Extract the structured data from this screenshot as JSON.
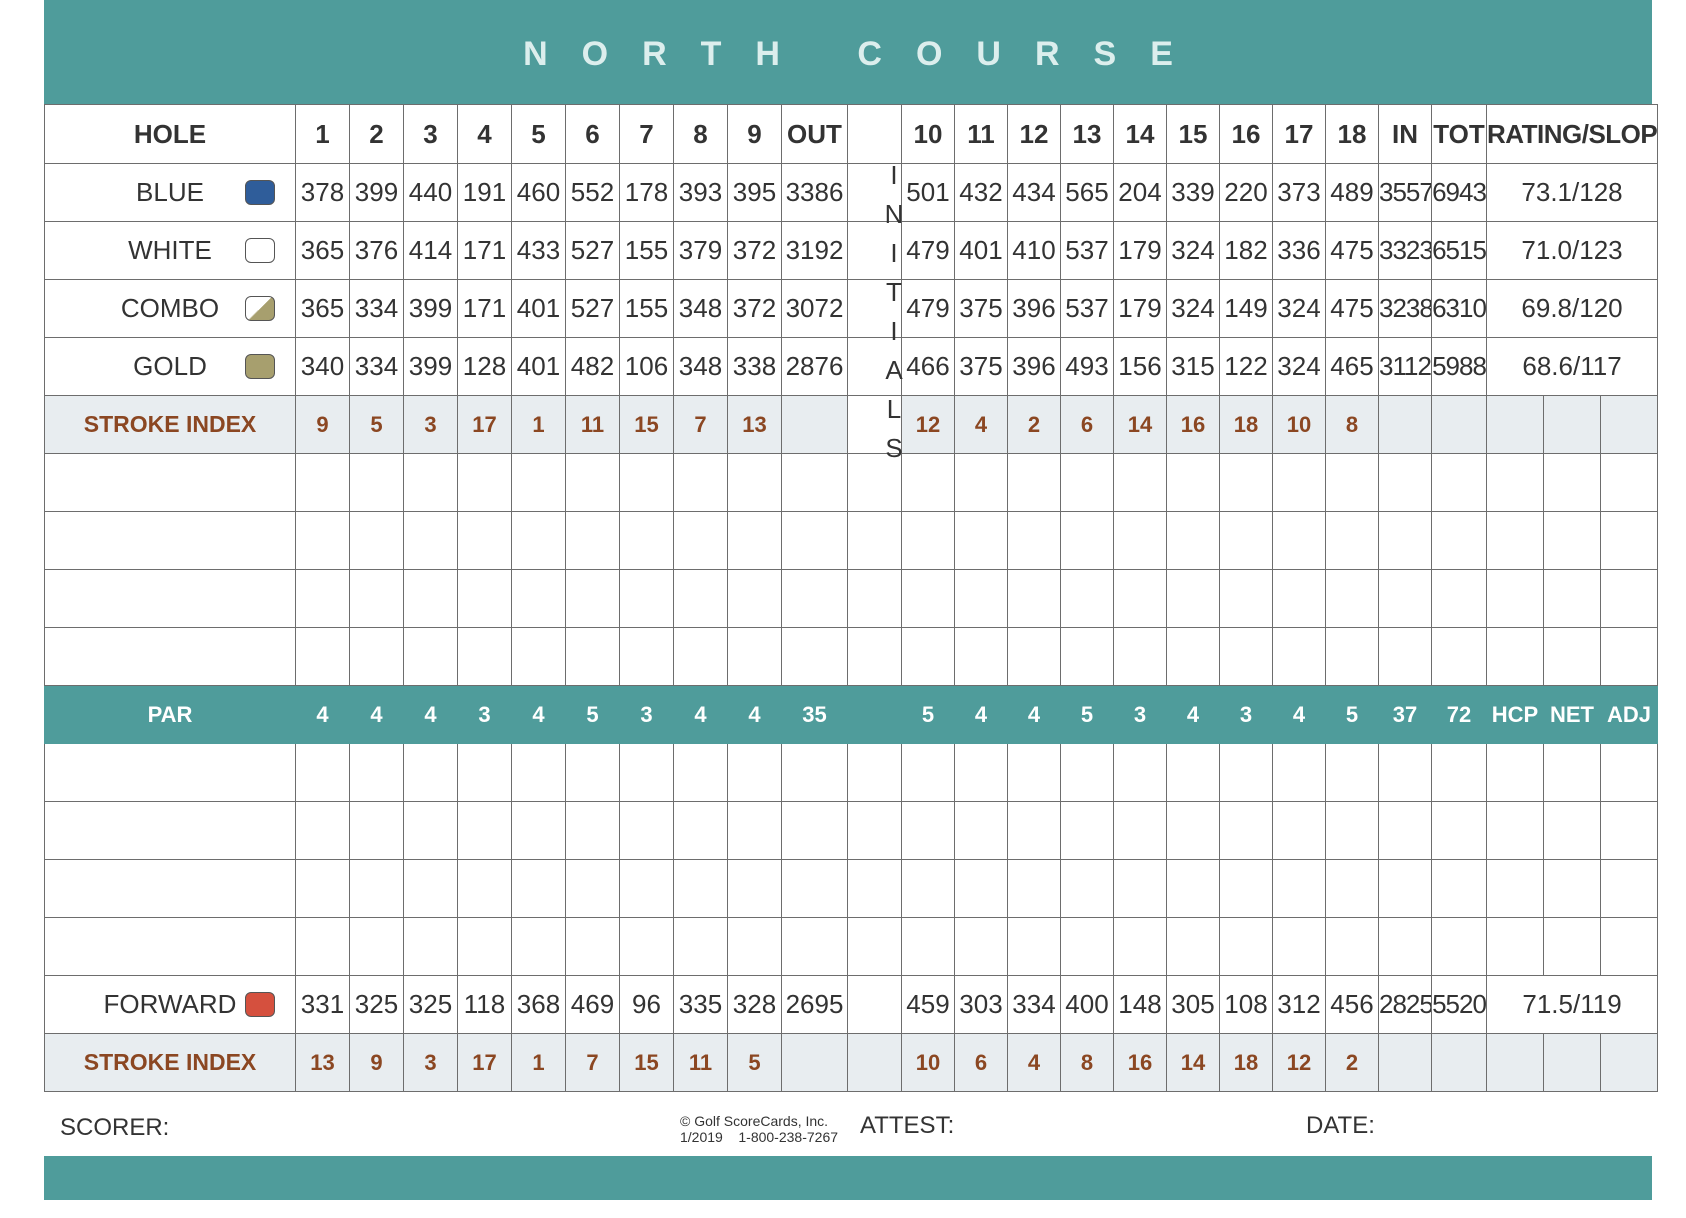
{
  "title": "NORTH COURSE",
  "initials": [
    "I",
    "N",
    "I",
    "T",
    "I",
    "A",
    "L",
    "S"
  ],
  "header": {
    "label": "HOLE",
    "front": [
      "1",
      "2",
      "3",
      "4",
      "5",
      "6",
      "7",
      "8",
      "9"
    ],
    "out": "OUT",
    "back": [
      "10",
      "11",
      "12",
      "13",
      "14",
      "15",
      "16",
      "17",
      "18"
    ],
    "in": "IN",
    "tot": "TOT",
    "rating": "RATING/SLOPE"
  },
  "tees": [
    {
      "name": "BLUE",
      "color": "#2f5d9a",
      "front": [
        "378",
        "399",
        "440",
        "191",
        "460",
        "552",
        "178",
        "393",
        "395"
      ],
      "out": "3386",
      "back": [
        "501",
        "432",
        "434",
        "565",
        "204",
        "339",
        "220",
        "373",
        "489"
      ],
      "in": "3557",
      "tot": "6943",
      "rating": "73.1/128"
    },
    {
      "name": "WHITE",
      "color": "#ffffff",
      "front": [
        "365",
        "376",
        "414",
        "171",
        "433",
        "527",
        "155",
        "379",
        "372"
      ],
      "out": "3192",
      "back": [
        "479",
        "401",
        "410",
        "537",
        "179",
        "324",
        "182",
        "336",
        "475"
      ],
      "in": "3323",
      "tot": "6515",
      "rating": "71.0/123"
    },
    {
      "name": "COMBO",
      "color": "#a79f6e",
      "front": [
        "365",
        "334",
        "399",
        "171",
        "401",
        "527",
        "155",
        "348",
        "372"
      ],
      "out": "3072",
      "back": [
        "479",
        "375",
        "396",
        "537",
        "179",
        "324",
        "149",
        "324",
        "475"
      ],
      "in": "3238",
      "tot": "6310",
      "rating": "69.8/120"
    },
    {
      "name": "GOLD",
      "color": "#a79f6e",
      "front": [
        "340",
        "334",
        "399",
        "128",
        "401",
        "482",
        "106",
        "348",
        "338"
      ],
      "out": "2876",
      "back": [
        "466",
        "375",
        "396",
        "493",
        "156",
        "315",
        "122",
        "324",
        "465"
      ],
      "in": "3112",
      "tot": "5988",
      "rating": "68.6/117"
    }
  ],
  "stroke_index_1": {
    "label": "STROKE INDEX",
    "front": [
      "9",
      "5",
      "3",
      "17",
      "1",
      "11",
      "15",
      "7",
      "13"
    ],
    "back": [
      "12",
      "4",
      "2",
      "6",
      "14",
      "16",
      "18",
      "10",
      "8"
    ]
  },
  "par": {
    "label": "PAR",
    "front": [
      "4",
      "4",
      "4",
      "3",
      "4",
      "5",
      "3",
      "4",
      "4"
    ],
    "out": "35",
    "back": [
      "5",
      "4",
      "4",
      "5",
      "3",
      "4",
      "3",
      "4",
      "5"
    ],
    "in": "37",
    "tot": "72",
    "hcp": "HCP",
    "net": "NET",
    "adj": "ADJ"
  },
  "forward": {
    "name": "FORWARD",
    "color": "#d5503e",
    "front": [
      "331",
      "325",
      "325",
      "118",
      "368",
      "469",
      "96",
      "335",
      "328"
    ],
    "out": "2695",
    "back": [
      "459",
      "303",
      "334",
      "400",
      "148",
      "305",
      "108",
      "312",
      "456"
    ],
    "in": "2825",
    "tot": "5520",
    "rating": "71.5/119"
  },
  "stroke_index_2": {
    "label": "STROKE INDEX",
    "front": [
      "13",
      "9",
      "3",
      "17",
      "1",
      "7",
      "15",
      "11",
      "5"
    ],
    "back": [
      "10",
      "6",
      "4",
      "8",
      "16",
      "14",
      "18",
      "12",
      "2"
    ]
  },
  "footer": {
    "scorer": "SCORER:",
    "attest": "ATTEST:",
    "date": "DATE:",
    "copyright": "Golf ScoreCards, Inc.",
    "copyright_line2": "1/2019    1-800-238-7267"
  }
}
